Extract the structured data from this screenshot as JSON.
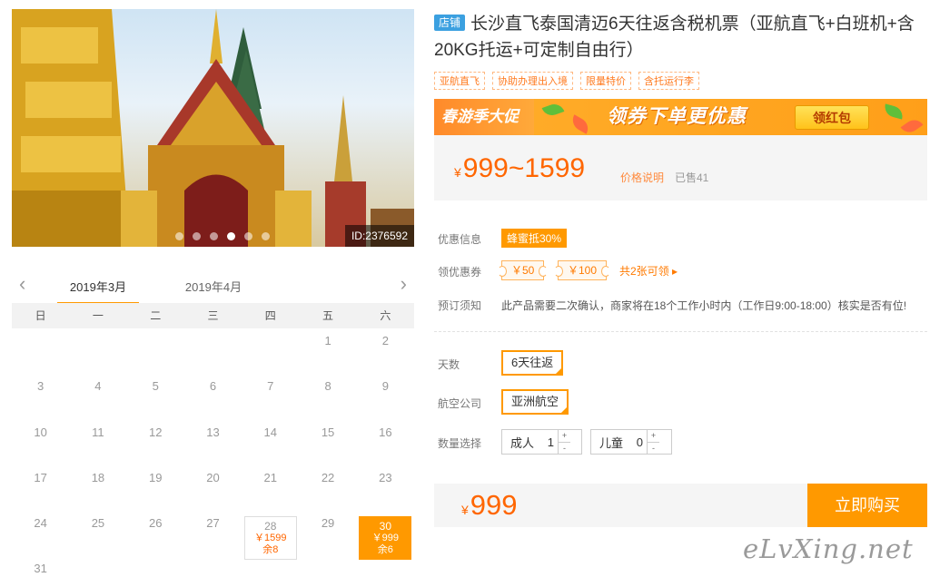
{
  "photo": {
    "id_label": "ID:2376592",
    "dots": 6,
    "active_dot": 3
  },
  "calendar": {
    "prev_icon": "chevron-left-icon",
    "next_icon": "chevron-right-icon",
    "tabs": [
      {
        "label": "2019年3月",
        "active": true
      },
      {
        "label": "2019年4月",
        "active": false
      }
    ],
    "weekdays": [
      "日",
      "一",
      "二",
      "三",
      "四",
      "五",
      "六"
    ],
    "lead_blank": 5,
    "days": [
      "1",
      "2",
      "3",
      "4",
      "5",
      "6",
      "7",
      "8",
      "9",
      "10",
      "11",
      "12",
      "13",
      "14",
      "15",
      "16",
      "17",
      "18",
      "19",
      "20",
      "21",
      "22",
      "23",
      "24",
      "25",
      "26",
      "27",
      "28",
      "29",
      "30",
      "31"
    ],
    "available": {
      "28": {
        "price": "￥1599",
        "remain": "余8",
        "selected": false
      },
      "30": {
        "price": "￥999",
        "remain": "余6",
        "selected": true
      }
    }
  },
  "product": {
    "store_badge": "店铺",
    "title": "长沙直飞泰国清迈6天往返含税机票（亚航直飞+白班机+含20KG托运+可定制自由行）",
    "tags": [
      "亚航直飞",
      "协助办理出入境",
      "限量特价",
      "含托运行李"
    ]
  },
  "banner": {
    "left_text": "春游季大促",
    "main_text": "领券下单更优惠",
    "button": "领红包"
  },
  "price": {
    "currency": "¥",
    "range": "999~1599",
    "note": "价格说明",
    "sold": "已售41"
  },
  "info": {
    "discount_label": "优惠信息",
    "discount_badge": "蜂蜜抵30%",
    "coupon_label": "领优惠券",
    "coupons": [
      "￥50",
      "￥100"
    ],
    "coupon_total": "共2张可领 ▸",
    "notice_label": "预订须知",
    "notice_text": "此产品需要二次确认，商家将在18个工作小时内（工作日9:00-18:00）核实是否有位!"
  },
  "options": {
    "days_label": "天数",
    "days_value": "6天往返",
    "airline_label": "航空公司",
    "airline_value": "亚洲航空",
    "qty_label": "数量选择",
    "adult_label": "成人",
    "adult_qty": "1",
    "child_label": "儿童",
    "child_qty": "0",
    "plus": "+",
    "minus": "-"
  },
  "buy": {
    "currency": "¥",
    "total": "999",
    "button": "立即购买"
  },
  "watermark": "eLvXing.net",
  "colors": {
    "accent": "#ff9900",
    "price": "#ff6600",
    "store_badge": "#3ba0e0"
  }
}
